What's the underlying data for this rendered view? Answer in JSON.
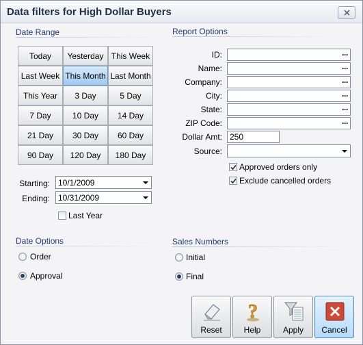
{
  "window": {
    "title": "Data filters for High Dollar Buyers"
  },
  "date_range": {
    "label": "Date Range",
    "buttons": [
      "Today",
      "Yesterday",
      "This Week",
      "Last Week",
      "This Month",
      "Last Month",
      "This Year",
      "3 Day",
      "5 Day",
      "7 Day",
      "10 Day",
      "14 Day",
      "21 Day",
      "30 Day",
      "60 Day",
      "90 Day",
      "120 Day",
      "180 Day"
    ],
    "active": "This Month",
    "starting_label": "Starting:",
    "starting_value": "10/1/2009",
    "ending_label": "Ending:",
    "ending_value": "10/31/2009",
    "last_year_label": "Last Year",
    "last_year_checked": false
  },
  "report_options": {
    "label": "Report Options",
    "id_label": "ID:",
    "name_label": "Name:",
    "company_label": "Company:",
    "city_label": "City:",
    "state_label": "State:",
    "zip_label": "ZIP Code:",
    "dollar_label": "Dollar Amt:",
    "dollar_value": "250",
    "source_label": "Source:",
    "source_value": "",
    "ellipsis": "···",
    "approved_label": "Approved orders only",
    "approved_checked": true,
    "exclude_label": "Exclude cancelled orders",
    "exclude_checked": true
  },
  "date_options": {
    "label": "Date Options",
    "order_label": "Order",
    "approval_label": "Approval",
    "selected": "Approval"
  },
  "sales_numbers": {
    "label": "Sales Numbers",
    "initial_label": "Initial",
    "final_label": "Final",
    "selected": "Final"
  },
  "actions": {
    "reset": "Reset",
    "help": "Help",
    "apply": "Apply",
    "cancel": "Cancel"
  },
  "colors": {
    "group_heading": "#1f3b78",
    "active_button": "#9fcaf0",
    "cancel_icon": "#c0392b"
  }
}
